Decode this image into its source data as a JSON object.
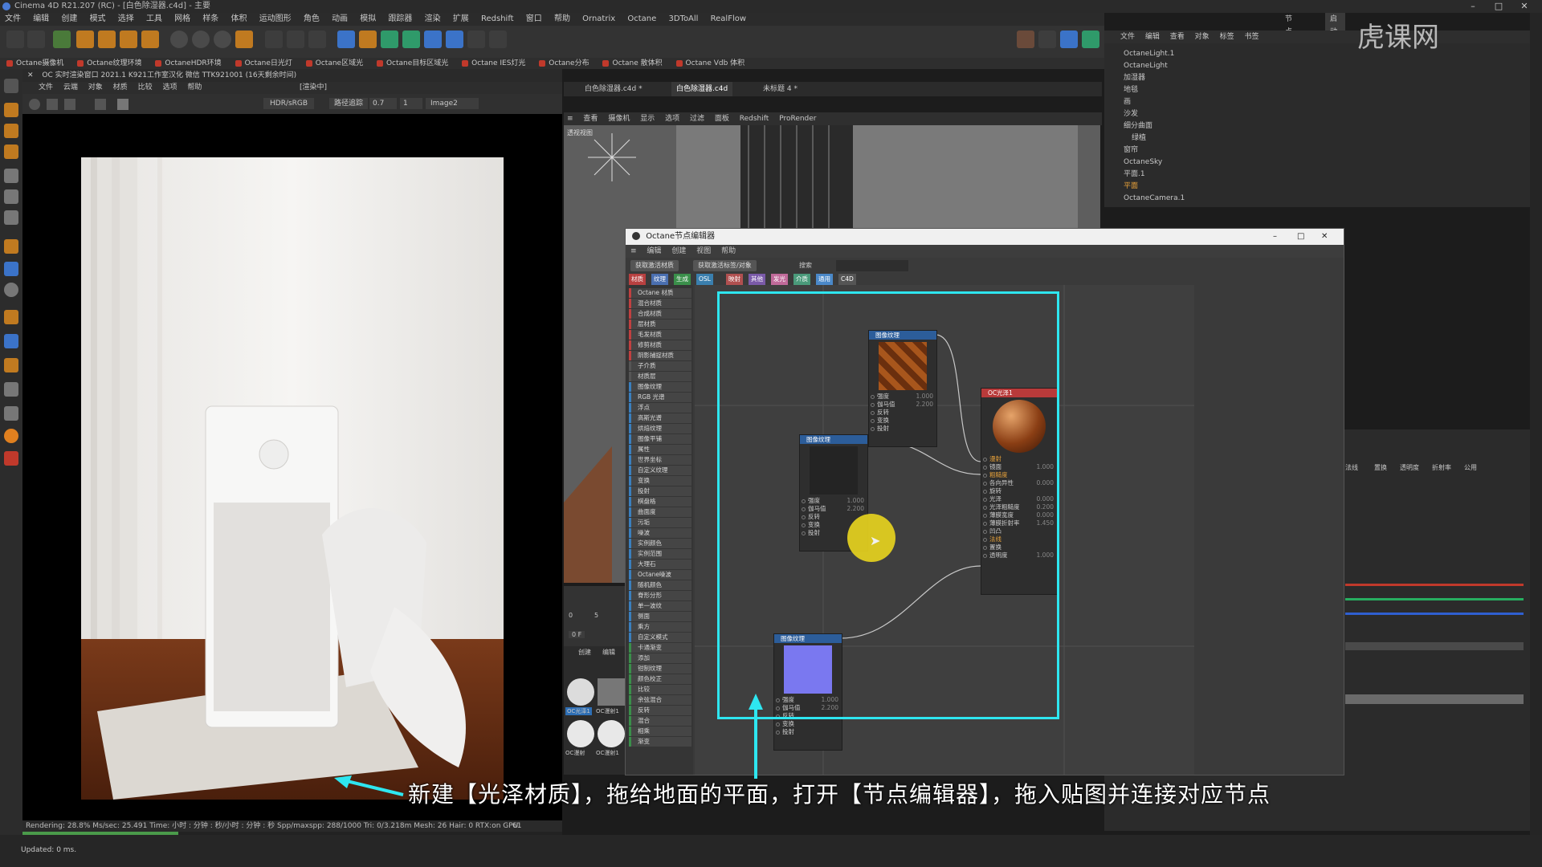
{
  "window": {
    "title": "Cinema 4D R21.207 (RC) - [白色除湿器.c4d] - 主要"
  },
  "menubar": [
    "文件",
    "编辑",
    "创建",
    "模式",
    "选择",
    "工具",
    "网格",
    "样条",
    "体积",
    "运动图形",
    "角色",
    "动画",
    "模拟",
    "跟踪器",
    "渲染",
    "扩展",
    "Redshift",
    "窗口",
    "帮助",
    "Ornatrix",
    "Octane",
    "3DToAll",
    "RealFlow"
  ],
  "layout_label": "节点空间:",
  "layout_value": "启动(用户)",
  "plugins": [
    "Octane摄像机",
    "Octane纹理环境",
    "OctaneHDR环境",
    "Octane日光灯",
    "Octane区域光",
    "Octane目标区域光",
    "Octane IES灯光",
    "Octane分布",
    "Octane 散体积",
    "Octane Vdb 体积"
  ],
  "ipr": {
    "header": "OC 实时渲染窗口  2021.1  K921工作室汉化  微信  TTK921001 (16天剩余时间)",
    "menu": [
      "文件",
      "云端",
      "对象",
      "材质",
      "比较",
      "选项",
      "帮助"
    ],
    "badge": "[渲染中]",
    "colorspace": "HDR/sRGB",
    "mode": "路径追踪",
    "value1": "0.7",
    "value2": "1",
    "image": "Image2",
    "status": "Rendering: 28.8%   Ms/sec: 25.491   Time: 小时 : 分钟 : 秒/小时 : 分钟 : 秒   Spp/maxspp: 288/1000   Tri: 0/3.218m  Mesh: 26   Hair: 0   RTX:on   GPU:",
    "gpu": "61",
    "progress": 0.288
  },
  "bottom_status": "Updated: 0 ms.",
  "viewport": {
    "tabs": [
      "白色除湿器.c4d *",
      "白色除湿器.c4d",
      "未标题 4 *"
    ],
    "menu": [
      "查看",
      "摄像机",
      "显示",
      "选项",
      "过滤",
      "面板",
      "Redshift",
      "ProRender"
    ],
    "label": "透视视图"
  },
  "timeline": {
    "start": "0",
    "mid": "5",
    "frame": "0 F"
  },
  "material_panel": {
    "menu": [
      "创建",
      "编辑"
    ],
    "mats": [
      "OC光泽1",
      "OC漫射1",
      "OC漫射",
      "OC漫射1"
    ]
  },
  "object_manager": {
    "menu": [
      "文件",
      "编辑",
      "查看",
      "对象",
      "标签",
      "书签"
    ],
    "objects": [
      "OctaneLight.1",
      "OctaneLight",
      "加湿器",
      "地毯",
      "画",
      "沙发",
      "细分曲面",
      "绿植",
      "窗帘",
      "OctaneSky",
      "平面.1",
      "平面",
      "OctaneCamera.1"
    ]
  },
  "attributes": {
    "tabs": [
      "法线",
      "置换",
      "透明度",
      "折射率",
      "公用"
    ]
  },
  "node_editor": {
    "title": "Octane节点编辑器",
    "menu": [
      "编辑",
      "创建",
      "视图",
      "帮助"
    ],
    "btn1": "获取激活材质",
    "btn2": "获取激活标签/对象",
    "search_label": "搜索",
    "categories": [
      "材质",
      "纹理",
      "生成",
      "OSL",
      "映射",
      "其他",
      "发光",
      "介质",
      "通用",
      "C4D"
    ],
    "category_colors": [
      "#b84040",
      "#4a6fb0",
      "#3a8f4a",
      "#3a7fae",
      "#b05050",
      "#7a5aa8",
      "#c06a9a",
      "#4a9a7a",
      "#4a88c8",
      "#555555"
    ],
    "list": [
      "Octane 材质",
      "混合材质",
      "合成材质",
      "层材质",
      "毛发材质",
      "修剪材质",
      "阴影捕捉材质",
      "子介质",
      "材质层",
      "图像纹理",
      "RGB 光谱",
      "浮点",
      "高斯光谱",
      "烘焙纹理",
      "图像平铺",
      "属性",
      "世界坐标",
      "自定义纹理",
      "变换",
      "投射",
      "棋盘格",
      "曲面度",
      "污垢",
      "噪波",
      "实例颜色",
      "实例范围",
      "大理石",
      "Octane噪波",
      "随机颜色",
      "脊形分形",
      "单一波纹",
      "侧面",
      "乘方",
      "自定义模式",
      "卡通渐变",
      "添加",
      "钳制纹理",
      "颜色校正",
      "比较",
      "余弦混合",
      "反转",
      "混合",
      "相乘",
      "渐变"
    ],
    "nodes": {
      "tex1": {
        "title": "图像纹理",
        "params": [
          [
            "强度",
            "1.000"
          ],
          [
            "伽马值",
            "2.200"
          ],
          [
            "反转",
            ""
          ],
          [
            "变换",
            ""
          ],
          [
            "投射",
            ""
          ]
        ]
      },
      "tex2": {
        "title": "图像纹理",
        "params": [
          [
            "强度",
            "1.000"
          ],
          [
            "伽马值",
            "2.200"
          ],
          [
            "反转",
            ""
          ],
          [
            "变换",
            ""
          ],
          [
            "投射",
            ""
          ]
        ]
      },
      "tex3": {
        "title": "图像纹理",
        "params": [
          [
            "强度",
            "1.000"
          ],
          [
            "伽马值",
            "2.200"
          ],
          [
            "反转",
            ""
          ],
          [
            "变换",
            ""
          ],
          [
            "投射",
            ""
          ]
        ]
      },
      "mat": {
        "title": "OC光泽1",
        "params": [
          [
            "漫射",
            ""
          ],
          [
            "镜面",
            "1.000"
          ],
          [
            "粗糙度",
            ""
          ],
          [
            "各向异性",
            "0.000"
          ],
          [
            "旋转",
            ""
          ],
          [
            "光泽",
            "0.000"
          ],
          [
            "光泽粗糙度",
            "0.200"
          ],
          [
            "薄膜宽度",
            "0.000"
          ],
          [
            "薄膜折射率",
            "1.450"
          ],
          [
            "凹凸",
            ""
          ],
          [
            "法线",
            ""
          ],
          [
            "置换",
            ""
          ],
          [
            "透明度",
            "1.000"
          ]
        ]
      }
    }
  },
  "caption": "新建【光泽材质】，拖给地面的平面，打开【节点编辑器】，拖入贴图并连接对应节点",
  "watermark": "虎课网",
  "colors": {
    "highlight": "#2ee6f0",
    "cursor": "#e6d21f",
    "accent": "#4a88c8"
  }
}
